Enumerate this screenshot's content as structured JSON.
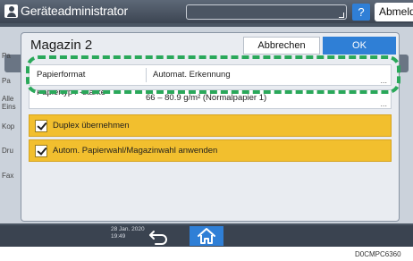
{
  "topbar": {
    "title": "Geräteadministrator",
    "help_label": "?",
    "logout_label": "Abmelden"
  },
  "background": {
    "items": [
      "Pa",
      "Pa",
      "Alle",
      "Eins",
      "Kop",
      "Dru",
      "Fax"
    ]
  },
  "dialog": {
    "title": "Magazin 2",
    "cancel_label": "Abbrechen",
    "ok_label": "OK",
    "rows": [
      {
        "label": "Papierformat",
        "value": "Automat. Erkennung"
      },
      {
        "label": "Papiertyp / -stärke",
        "value": "66 – 80.9 g/m² (Normalpapier 1)"
      }
    ],
    "checks": [
      {
        "label": "Duplex übernehmen",
        "checked": true
      },
      {
        "label": "Autom. Papierwahl/Magazinwahl anwenden",
        "checked": true
      }
    ],
    "dots": "..."
  },
  "bottombar": {
    "date": "28 Jan. 2020",
    "time": "19:49"
  },
  "caption": "D0CMPC6360",
  "colors": {
    "accent_blue": "#2f7fd6",
    "check_yellow": "#f2bf2e",
    "highlight_green": "#2aa85a"
  },
  "icons": [
    "user-icon",
    "help-icon",
    "back-arrow-icon",
    "home-icon",
    "checkmark-icon"
  ]
}
